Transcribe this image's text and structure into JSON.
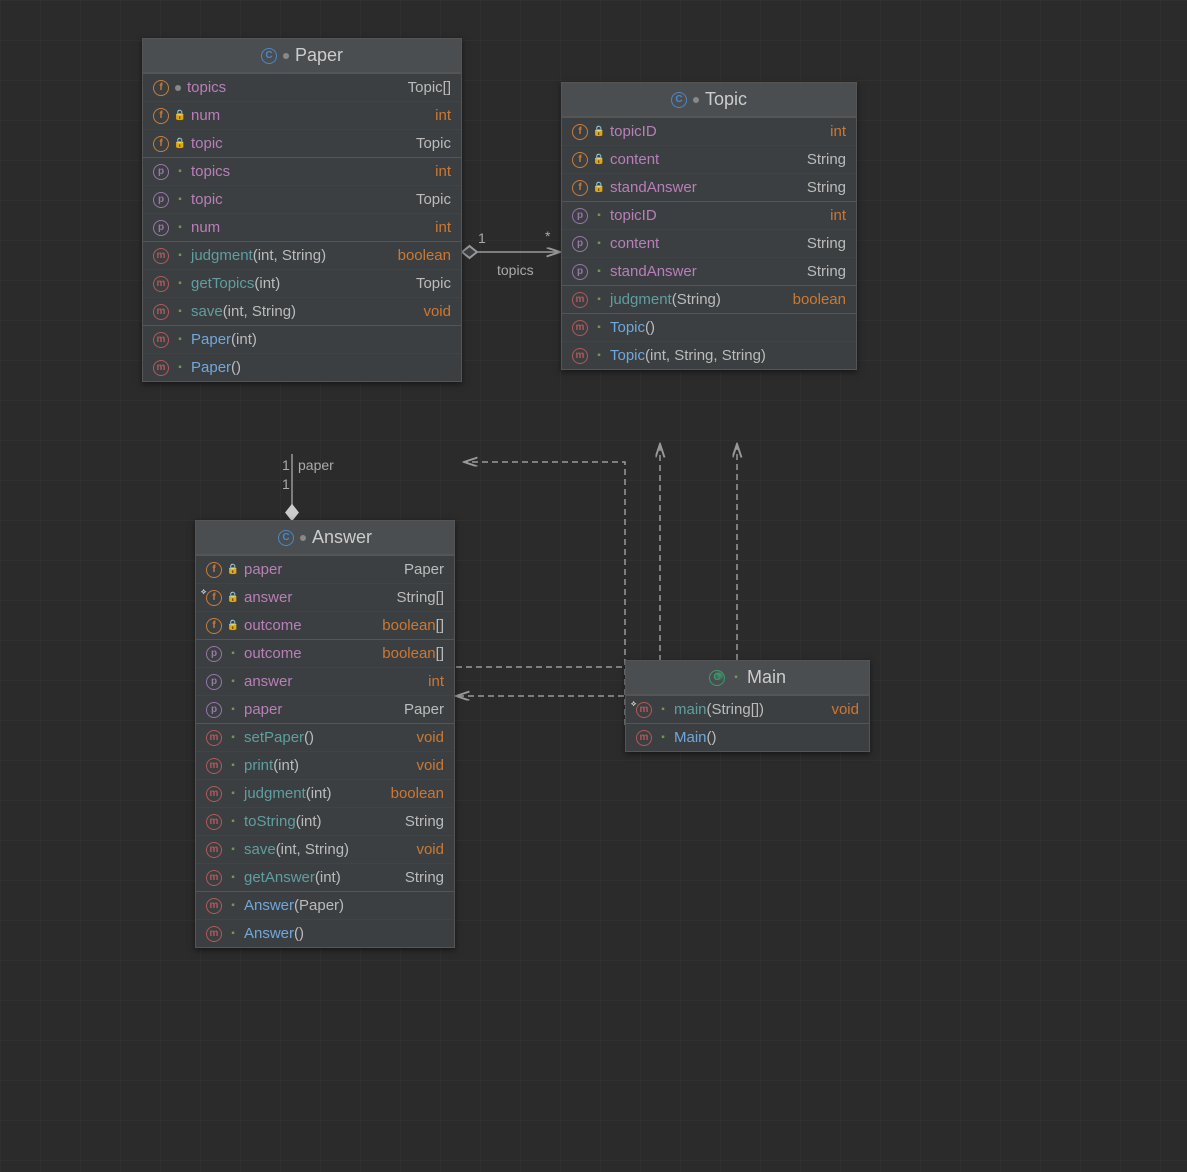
{
  "classes": {
    "paper": {
      "name": "Paper",
      "fields": [
        {
          "icon": "f",
          "vis": "open",
          "name": "topics",
          "type": "Topic[]",
          "dot": true
        },
        {
          "icon": "f",
          "vis": "lock",
          "name": "num",
          "type": "int"
        },
        {
          "icon": "f",
          "vis": "lock",
          "name": "topic",
          "type": "Topic"
        }
      ],
      "props": [
        {
          "icon": "p",
          "vis": "pub",
          "name": "topics",
          "type": "int"
        },
        {
          "icon": "p",
          "vis": "pub",
          "name": "topic",
          "type": "Topic"
        },
        {
          "icon": "p",
          "vis": "pub",
          "name": "num",
          "type": "int"
        }
      ],
      "methods": [
        {
          "icon": "m",
          "vis": "pub",
          "name": "judgment",
          "params": "(int, String)",
          "ret": "boolean"
        },
        {
          "icon": "m",
          "vis": "pub",
          "name": "getTopics",
          "params": "(int)",
          "ret": "Topic"
        },
        {
          "icon": "m",
          "vis": "pub",
          "name": "save",
          "params": "(int, String)",
          "ret": "void"
        }
      ],
      "ctors": [
        {
          "icon": "m",
          "vis": "pub",
          "name": "Paper",
          "params": "(int)"
        },
        {
          "icon": "m",
          "vis": "pub",
          "name": "Paper",
          "params": "()"
        }
      ]
    },
    "topic": {
      "name": "Topic",
      "fields": [
        {
          "icon": "f",
          "vis": "lock",
          "name": "topicID",
          "type": "int"
        },
        {
          "icon": "f",
          "vis": "lock",
          "name": "content",
          "type": "String"
        },
        {
          "icon": "f",
          "vis": "lock",
          "name": "standAnswer",
          "type": "String"
        }
      ],
      "props": [
        {
          "icon": "p",
          "vis": "pub",
          "name": "topicID",
          "type": "int"
        },
        {
          "icon": "p",
          "vis": "pub",
          "name": "content",
          "type": "String"
        },
        {
          "icon": "p",
          "vis": "pub",
          "name": "standAnswer",
          "type": "String"
        }
      ],
      "methods": [
        {
          "icon": "m",
          "vis": "pub",
          "name": "judgment",
          "params": "(String)",
          "ret": "boolean"
        }
      ],
      "ctors": [
        {
          "icon": "m",
          "vis": "pub",
          "name": "Topic",
          "params": "()"
        },
        {
          "icon": "m",
          "vis": "pub",
          "name": "Topic",
          "params": "(int, String, String)"
        }
      ]
    },
    "answer": {
      "name": "Answer",
      "fields": [
        {
          "icon": "f",
          "vis": "lock",
          "name": "paper",
          "type": "Paper"
        },
        {
          "icon": "f",
          "vis": "lock",
          "name": "answer",
          "type": "String[]",
          "tag": true
        },
        {
          "icon": "f",
          "vis": "lock",
          "name": "outcome",
          "type": "boolean[]"
        }
      ],
      "props": [
        {
          "icon": "p",
          "vis": "pub",
          "name": "outcome",
          "type": "boolean[]"
        },
        {
          "icon": "p",
          "vis": "pub",
          "name": "answer",
          "type": "int"
        },
        {
          "icon": "p",
          "vis": "pub",
          "name": "paper",
          "type": "Paper"
        }
      ],
      "methods": [
        {
          "icon": "m",
          "vis": "pub",
          "name": "setPaper",
          "params": "()",
          "ret": "void"
        },
        {
          "icon": "m",
          "vis": "pub",
          "name": "print",
          "params": "(int)",
          "ret": "void"
        },
        {
          "icon": "m",
          "vis": "pub",
          "name": "judgment",
          "params": "(int)",
          "ret": "boolean"
        },
        {
          "icon": "m",
          "vis": "pub",
          "name": "toString",
          "params": "(int)",
          "ret": "String"
        },
        {
          "icon": "m",
          "vis": "pub",
          "name": "save",
          "params": "(int, String)",
          "ret": "void"
        },
        {
          "icon": "m",
          "vis": "pub",
          "name": "getAnswer",
          "params": "(int)",
          "ret": "String"
        }
      ],
      "ctors": [
        {
          "icon": "m",
          "vis": "pub",
          "name": "Answer",
          "params": "(Paper)"
        },
        {
          "icon": "m",
          "vis": "pub",
          "name": "Answer",
          "params": "()"
        }
      ]
    },
    "main": {
      "name": "Main",
      "methods": [
        {
          "icon": "m",
          "vis": "pub",
          "name": "main",
          "params": "(String[])",
          "ret": "void"
        }
      ],
      "ctors": [
        {
          "icon": "m",
          "vis": "pub",
          "name": "Main",
          "params": "()"
        }
      ]
    }
  },
  "relations": {
    "paper_topic": {
      "mult_left": "1",
      "mult_right": "*",
      "label": "topics"
    },
    "answer_paper": {
      "mult_top": "1",
      "mult_bottom": "1",
      "label": "paper"
    }
  }
}
